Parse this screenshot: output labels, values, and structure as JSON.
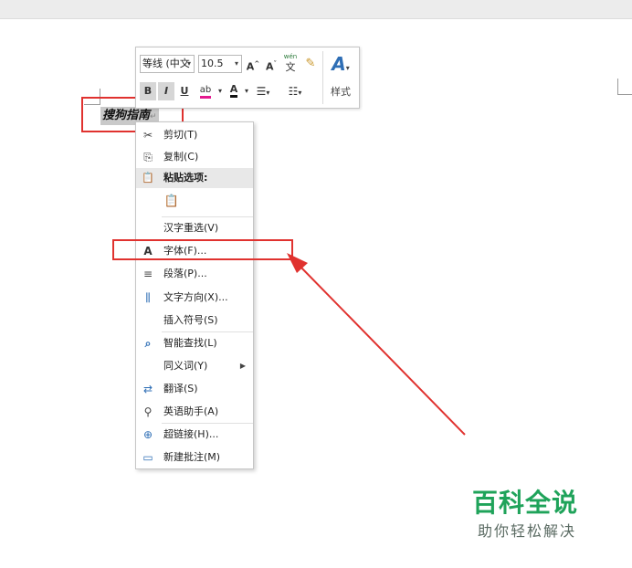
{
  "document": {
    "selected_text": "搜狗指南",
    "paragraph_mark": "↵"
  },
  "mini_toolbar": {
    "font_name": "等线 (中文",
    "font_size": "10.5",
    "grow_font": "A",
    "shrink_font": "A",
    "phonetic_guide": "wén",
    "phonetic_char": "文",
    "bold": "B",
    "italic": "I",
    "underline": "U",
    "highlight": "ab",
    "font_color": "A",
    "styles_label": "样式"
  },
  "context_menu": {
    "items": [
      {
        "label": "剪切(T)",
        "icon": "scissors-icon",
        "glyph": "✂"
      },
      {
        "label": "复制(C)",
        "icon": "copy-icon",
        "glyph": "⎘"
      },
      {
        "label": "粘贴选项:",
        "icon": "clipboard-icon",
        "glyph": "📋"
      },
      {
        "label": "",
        "icon": "paste-keep-text-icon",
        "glyph": "📋"
      },
      {
        "label": "汉字重选(V)",
        "icon": "",
        "glyph": ""
      },
      {
        "label": "字体(F)...",
        "icon": "font-icon",
        "glyph": "A"
      },
      {
        "label": "段落(P)...",
        "icon": "paragraph-icon",
        "glyph": "≡"
      },
      {
        "label": "文字方向(X)...",
        "icon": "text-direction-icon",
        "glyph": "⫼"
      },
      {
        "label": "插入符号(S)",
        "icon": "",
        "glyph": ""
      },
      {
        "label": "智能查找(L)",
        "icon": "smart-lookup-icon",
        "glyph": "⌕"
      },
      {
        "label": "同义词(Y)",
        "icon": "",
        "glyph": ""
      },
      {
        "label": "翻译(S)",
        "icon": "translate-icon",
        "glyph": "⇄"
      },
      {
        "label": "英语助手(A)",
        "icon": "english-assistant-icon",
        "glyph": "⚲"
      },
      {
        "label": "超链接(H)...",
        "icon": "hyperlink-icon",
        "glyph": "⊕"
      },
      {
        "label": "新建批注(M)",
        "icon": "new-comment-icon",
        "glyph": "▭"
      }
    ]
  },
  "watermark": {
    "title": "百科全说",
    "subtitle": "助你轻松解决"
  },
  "colors": {
    "annotation_red": "#e0322f",
    "watermark_green": "#1fa35a",
    "highlight_magenta": "#e4198f"
  }
}
